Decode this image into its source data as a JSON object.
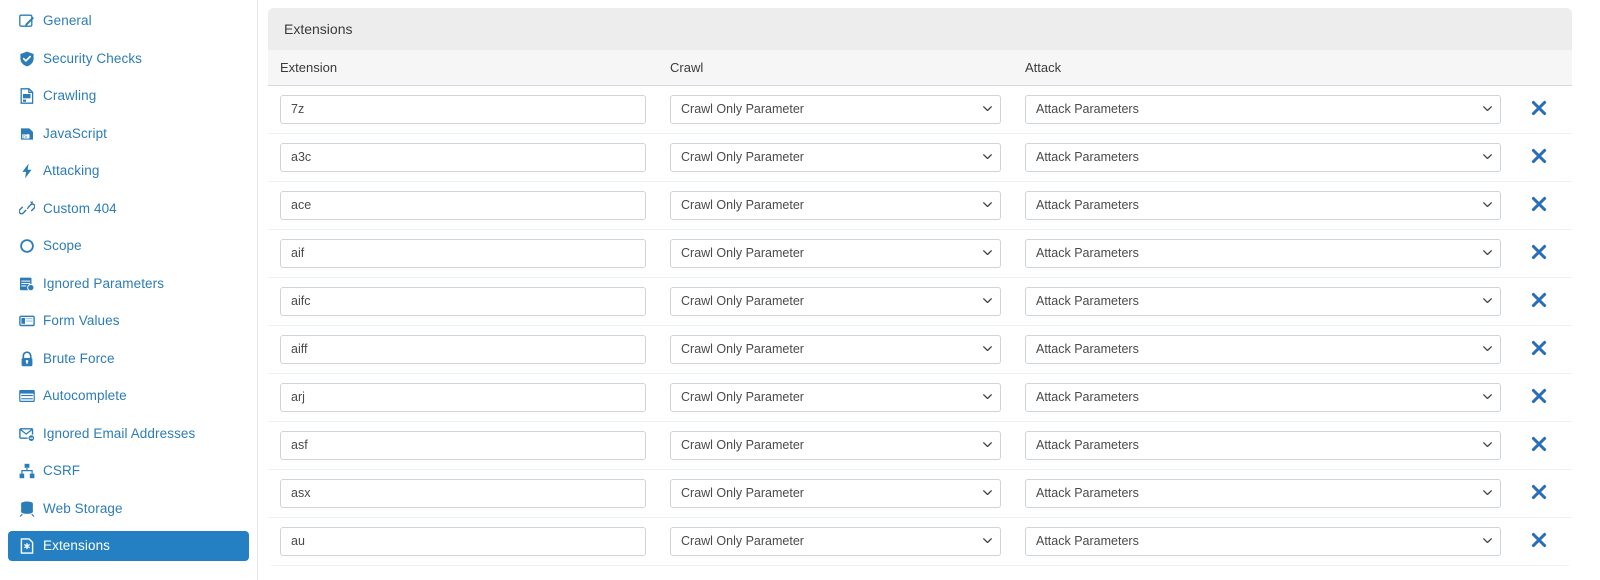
{
  "sidebar": {
    "items": [
      {
        "label": "General",
        "icon": "edit-icon",
        "active": false
      },
      {
        "label": "Security Checks",
        "icon": "shield-check-icon",
        "active": false
      },
      {
        "label": "Crawling",
        "icon": "document-list-icon",
        "active": false
      },
      {
        "label": "JavaScript",
        "icon": "javascript-file-icon",
        "active": false
      },
      {
        "label": "Attacking",
        "icon": "lightning-bolt-icon",
        "active": false
      },
      {
        "label": "Custom 404",
        "icon": "broken-link-icon",
        "active": false
      },
      {
        "label": "Scope",
        "icon": "circle-target-icon",
        "active": false
      },
      {
        "label": "Ignored Parameters",
        "icon": "table-settings-icon",
        "active": false
      },
      {
        "label": "Form Values",
        "icon": "form-window-icon",
        "active": false
      },
      {
        "label": "Brute Force",
        "icon": "padlock-icon",
        "active": false
      },
      {
        "label": "Autocomplete",
        "icon": "list-rows-icon",
        "active": false
      },
      {
        "label": "Ignored Email Addresses",
        "icon": "envelope-minus-icon",
        "active": false
      },
      {
        "label": "CSRF",
        "icon": "network-nodes-icon",
        "active": false
      },
      {
        "label": "Web Storage",
        "icon": "database-stack-icon",
        "active": false
      },
      {
        "label": "Extensions",
        "icon": "file-asterisk-icon",
        "active": true
      }
    ]
  },
  "panel": {
    "title": "Extensions"
  },
  "table": {
    "columns": [
      "Extension",
      "Crawl",
      "Attack"
    ],
    "crawl_placeholder": "Crawl Only Parameter",
    "attack_placeholder": "Attack Parameters",
    "crawl_options": [
      "Crawl Only Parameter"
    ],
    "attack_options": [
      "Attack Parameters"
    ],
    "delete_label": "✖",
    "rows": [
      {
        "extension": "7z",
        "crawl": "Crawl Only Parameter",
        "attack": "Attack Parameters"
      },
      {
        "extension": "a3c",
        "crawl": "Crawl Only Parameter",
        "attack": "Attack Parameters"
      },
      {
        "extension": "ace",
        "crawl": "Crawl Only Parameter",
        "attack": "Attack Parameters"
      },
      {
        "extension": "aif",
        "crawl": "Crawl Only Parameter",
        "attack": "Attack Parameters"
      },
      {
        "extension": "aifc",
        "crawl": "Crawl Only Parameter",
        "attack": "Attack Parameters"
      },
      {
        "extension": "aiff",
        "crawl": "Crawl Only Parameter",
        "attack": "Attack Parameters"
      },
      {
        "extension": "arj",
        "crawl": "Crawl Only Parameter",
        "attack": "Attack Parameters"
      },
      {
        "extension": "asf",
        "crawl": "Crawl Only Parameter",
        "attack": "Attack Parameters"
      },
      {
        "extension": "asx",
        "crawl": "Crawl Only Parameter",
        "attack": "Attack Parameters"
      },
      {
        "extension": "au",
        "crawl": "Crawl Only Parameter",
        "attack": "Attack Parameters"
      }
    ]
  },
  "colors": {
    "accent": "#2580c3",
    "nav_link": "#2c7cb8",
    "card_header_bg": "#ededed",
    "table_header_bg": "#f6f6f6",
    "delete_icon": "#2a6ebb"
  }
}
